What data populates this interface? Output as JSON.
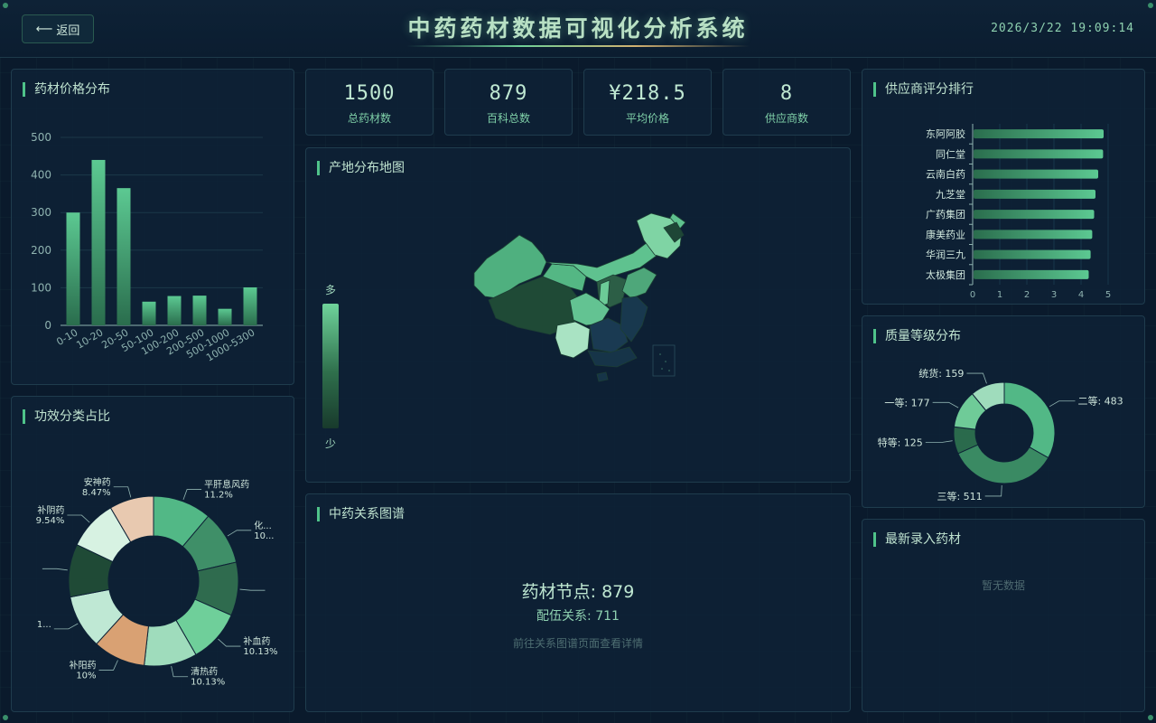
{
  "header": {
    "back_label": "返回",
    "title": "中药药材数据可视化分析系统",
    "datetime": "2026/3/22 19:09:14"
  },
  "stats": [
    {
      "value": "1500",
      "label": "总药材数"
    },
    {
      "value": "879",
      "label": "百科总数"
    },
    {
      "value": "¥218.5",
      "label": "平均价格"
    },
    {
      "value": "8",
      "label": "供应商数"
    }
  ],
  "panels": {
    "price": "药材价格分布",
    "efficacy": "功效分类占比",
    "map": "产地分布地图",
    "graph": "中药关系图谱",
    "supplier": "供应商评分排行",
    "quality": "质量等级分布",
    "latest": "最新录入药材"
  },
  "map_legend": {
    "high": "多",
    "low": "少"
  },
  "graph": {
    "nodes": "药材节点: 879",
    "relations": "配伍关系: 711",
    "hint": "前往关系图谱页面查看详情"
  },
  "latest": {
    "empty": "暂无数据"
  },
  "colors": {
    "accent": "#4fc38a",
    "bar": "#52b886",
    "background": "#0a1a2c",
    "panel": "#0e2236"
  },
  "chart_data": [
    {
      "type": "bar",
      "categories": [
        "0-10",
        "10-20",
        "20-50",
        "50-100",
        "100-200",
        "200-500",
        "500-1000",
        "1000-5300"
      ],
      "values": [
        300,
        440,
        365,
        63,
        78,
        79,
        44,
        101
      ],
      "ylim": [
        0,
        500
      ],
      "yticks": [
        0,
        100,
        200,
        300,
        400,
        500
      ]
    },
    {
      "type": "pie",
      "slices": [
        {
          "name": "平肝息风药",
          "percent": "11.2%",
          "value": 11.2,
          "color": "#52b886"
        },
        {
          "name": "化...",
          "percent": "10...",
          "value": 10.3,
          "color": "#3f8f68"
        },
        {
          "name": "",
          "percent": "",
          "value": 10.2,
          "color": "#2f6b4e"
        },
        {
          "name": "补血药",
          "percent": "10.13%",
          "value": 10.13,
          "color": "#6fcf9a"
        },
        {
          "name": "清热药",
          "percent": "10.13%",
          "value": 10.13,
          "color": "#9fdcbc"
        },
        {
          "name": "补阳药",
          "percent": "10%",
          "value": 10.0,
          "color": "#d9a173"
        },
        {
          "name": "1...",
          "percent": "",
          "value": 10.3,
          "color": "#bfe8d4"
        },
        {
          "name": "",
          "percent": "",
          "value": 10.1,
          "color": "#1f4a36"
        },
        {
          "name": "补阴药",
          "percent": "9.54%",
          "value": 9.54,
          "color": "#d7f2e2"
        },
        {
          "name": "安神药",
          "percent": "8.47%",
          "value": 8.47,
          "color": "#e8c9b0"
        }
      ]
    },
    {
      "type": "bar",
      "orientation": "horizontal",
      "categories": [
        "东阿阿胶",
        "同仁堂",
        "云南白药",
        "九芝堂",
        "广药集团",
        "康美药业",
        "华润三九",
        "太极集团"
      ],
      "values": [
        4.8,
        4.78,
        4.6,
        4.5,
        4.45,
        4.38,
        4.32,
        4.25
      ],
      "xlim": [
        0,
        5
      ],
      "xticks": [
        0,
        1,
        2,
        3,
        4,
        5
      ]
    },
    {
      "type": "pie",
      "slices": [
        {
          "name": "二等",
          "value": 483,
          "label": "二等: 483",
          "color": "#52b886"
        },
        {
          "name": "三等",
          "value": 511,
          "label": "三等: 511",
          "color": "#3a8a63"
        },
        {
          "name": "特等",
          "value": 125,
          "label": "特等: 125",
          "color": "#2a6a4c"
        },
        {
          "name": "一等",
          "value": 177,
          "label": "一等: 177",
          "color": "#6fcb98"
        },
        {
          "name": "统货",
          "value": 159,
          "label": "统货: 159",
          "color": "#9fdcbc"
        }
      ]
    }
  ]
}
